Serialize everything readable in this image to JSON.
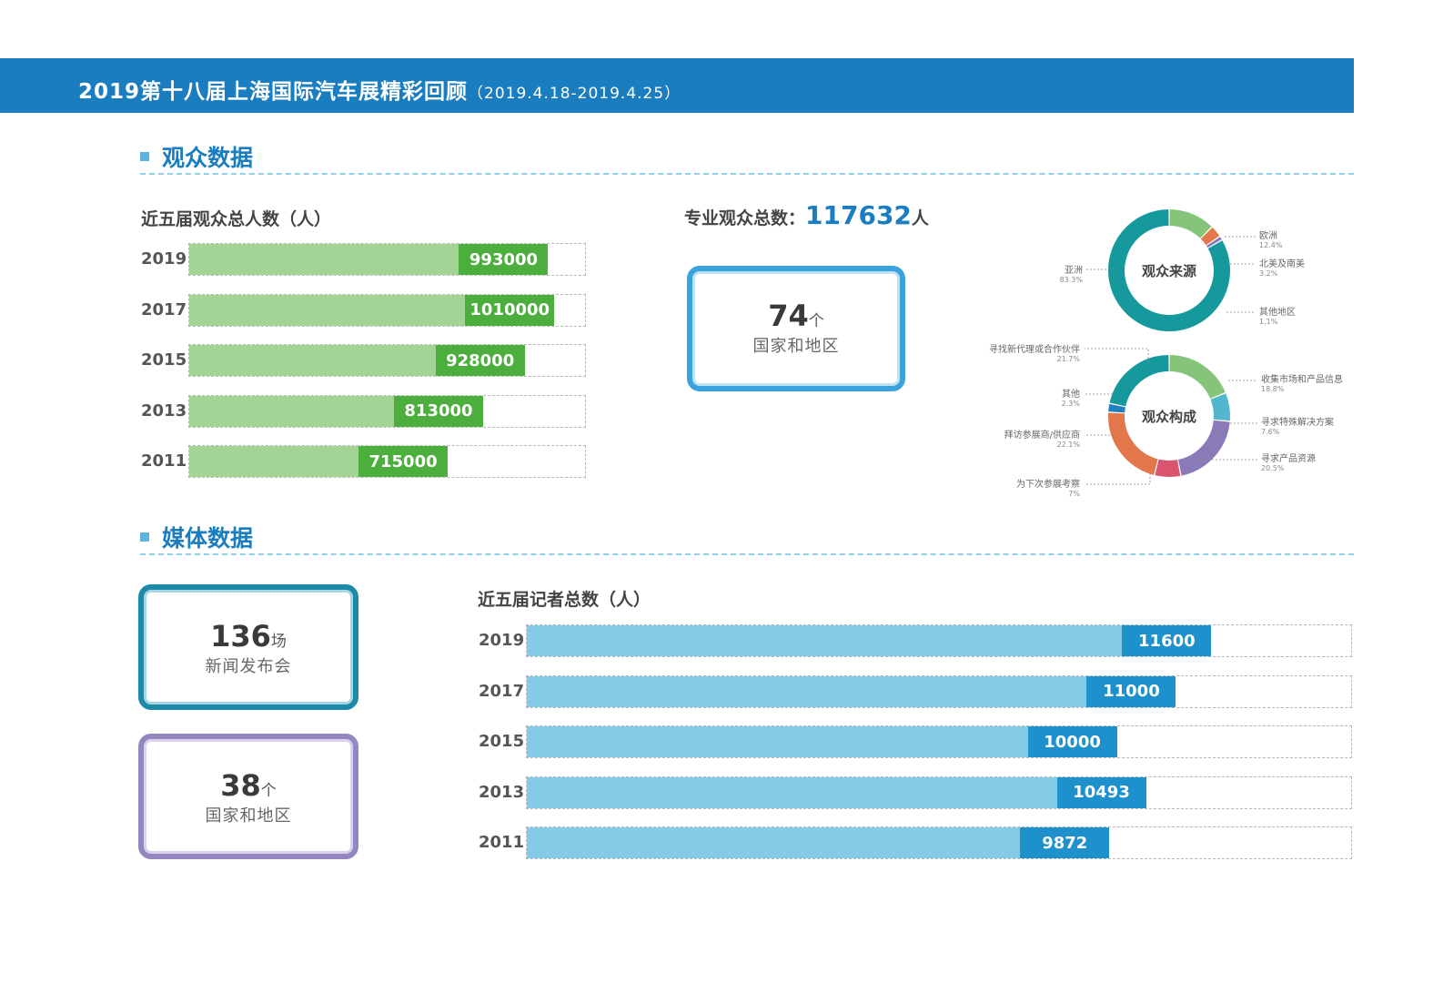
{
  "header": {
    "title": "2019第十八届上海国际汽车展精彩回顾",
    "date_range": "（2019.4.18-2019.4.25）"
  },
  "sections": {
    "audience": "观众数据",
    "media": "媒体数据"
  },
  "audience_stats": {
    "professional_label": "专业观众总数：",
    "professional_total": "117632",
    "professional_unit": "人",
    "countries_num": "74",
    "countries_unit": "个",
    "countries_label": "国家和地区"
  },
  "media_stats": {
    "press_num": "136",
    "press_unit": "场",
    "press_label": "新闻发布会",
    "countries_num": "38",
    "countries_unit": "个",
    "countries_label": "国家和地区"
  },
  "colors": {
    "header": "#1a7dbf",
    "audience_fill": "#a4d495",
    "audience_value": "#4cae3c",
    "media_fill": "#85cae6",
    "media_value": "#1e90cc",
    "box_blue": "#3aa3dc",
    "box_teal": "#1d8aa8",
    "box_purple": "#9487c0"
  },
  "chart_data": [
    {
      "type": "bar",
      "title": "近五届观众总人数（人）",
      "categories": [
        "2019",
        "2017",
        "2015",
        "2013",
        "2011"
      ],
      "values": [
        993000,
        1010000,
        928000,
        813000,
        715000
      ],
      "value_labels": [
        "993000",
        "1010000",
        "928000",
        "813000",
        "715000"
      ],
      "orientation": "horizontal",
      "xlim": [
        0,
        1100000
      ]
    },
    {
      "type": "pie",
      "title": "观众来源",
      "labels": [
        "欧洲",
        "北美及南美",
        "其他地区",
        "亚洲"
      ],
      "values": [
        12.4,
        3.2,
        1.1,
        83.3
      ],
      "value_labels": [
        "12.4%",
        "3.2%",
        "1.1%",
        "83.3%"
      ],
      "colors": [
        "#86c47a",
        "#e3764a",
        "#8a7bb8",
        "#16999d"
      ]
    },
    {
      "type": "pie",
      "title": "观众构成",
      "labels": [
        "收集市场和产品信息",
        "寻求特殊解决方案",
        "寻求产品资源",
        "为下次参展考察",
        "拜访参展商/供应商",
        "其他",
        "寻找新代理或合作伙伴"
      ],
      "values": [
        18.8,
        7.6,
        20.5,
        7,
        22.1,
        2.3,
        21.7
      ],
      "value_labels": [
        "18.8%",
        "7.6%",
        "20.5%",
        "7%",
        "22.1%",
        "2.3%",
        "21.7%"
      ],
      "colors": [
        "#86c47a",
        "#52b6cc",
        "#8a7bb8",
        "#d9546e",
        "#e3764a",
        "#1f7fc0",
        "#16999d"
      ]
    },
    {
      "type": "bar",
      "title": "近五届记者总数（人）",
      "categories": [
        "2019",
        "2017",
        "2015",
        "2013",
        "2011"
      ],
      "values": [
        11600,
        11000,
        10000,
        10493,
        9872
      ],
      "value_labels": [
        "11600",
        "11000",
        "10000",
        "10493",
        "9872"
      ],
      "orientation": "horizontal",
      "xlim": [
        0,
        14000
      ]
    }
  ]
}
